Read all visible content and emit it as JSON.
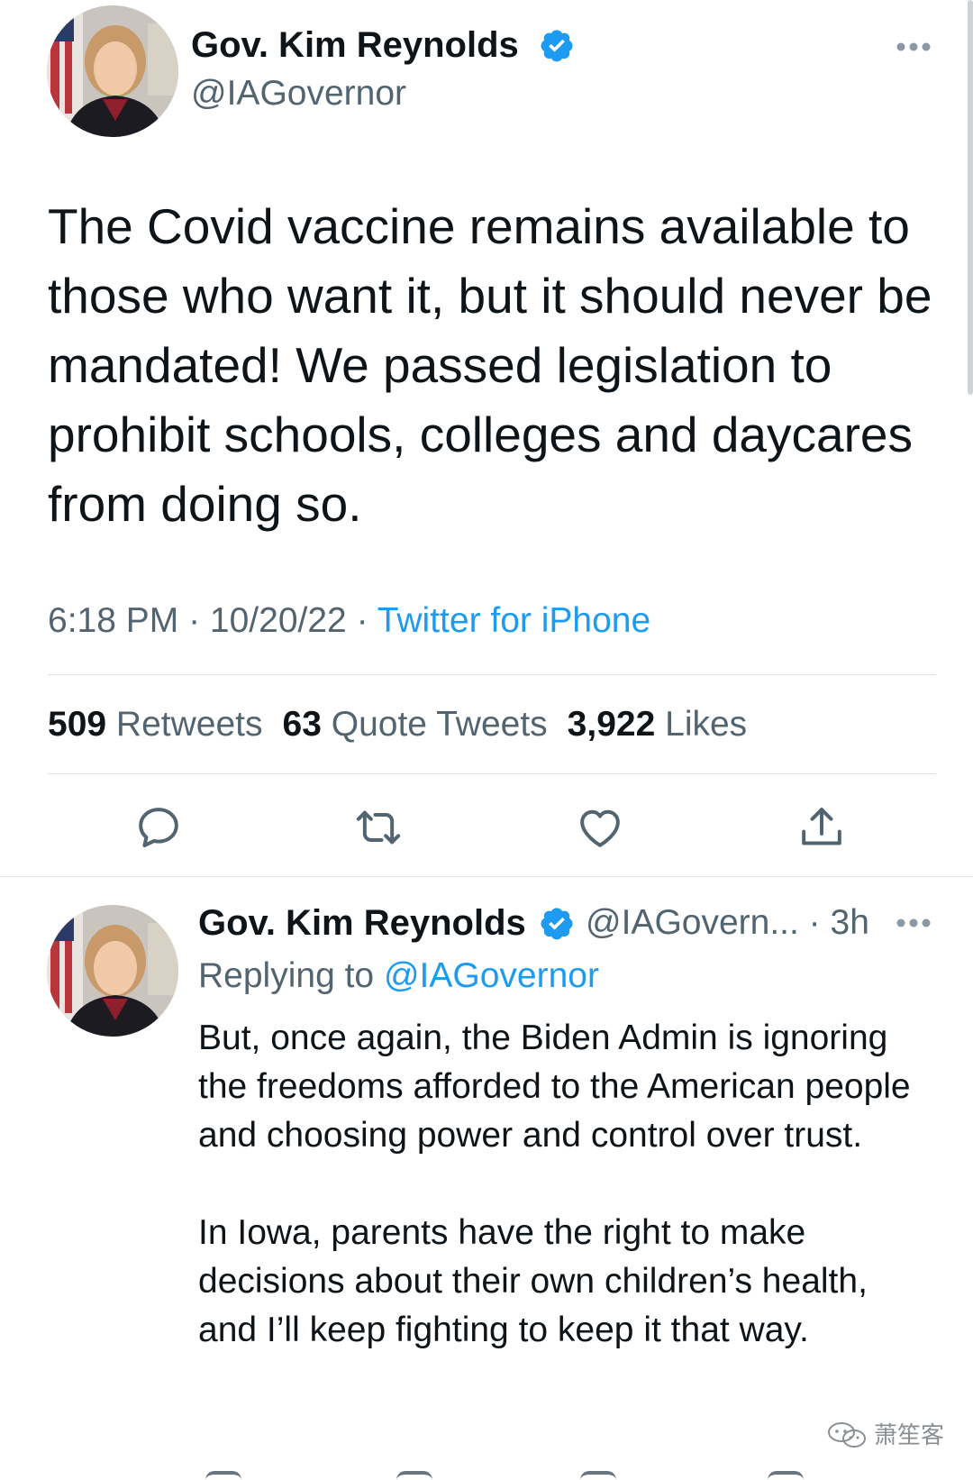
{
  "tweet": {
    "author_name": "Gov. Kim Reynolds",
    "handle": "@IAGovernor",
    "text": "The Covid vaccine remains available to those who want it, but it should never be mandated! We passed legislation to prohibit schools, colleges and daycares from doing so.",
    "time": "6:18 PM",
    "date": "10/20/22",
    "separator": " · ",
    "source": "Twitter for iPhone",
    "stats": {
      "retweets_count": "509",
      "retweets_label": "Retweets",
      "quotes_count": "63",
      "quotes_label": "Quote Tweets",
      "likes_count": "3,922",
      "likes_label": "Likes"
    }
  },
  "reply": {
    "author_name": "Gov. Kim Reynolds",
    "handle_truncated": "@IAGovern...",
    "separator": " · ",
    "age": "3h",
    "replying_to_label": "Replying to",
    "replying_to_handle": "@IAGovernor",
    "paragraph_1": "But, once again, the Biden Admin is ignoring the freedoms afforded to the American people and choosing power and control over trust.",
    "paragraph_2": "In Iowa, parents have the right to make decisions about their own children’s health, and I’ll keep fighting to keep it that way."
  },
  "watermark": {
    "text": "萧笙客",
    "icon": "wechat-icon"
  },
  "icons": {
    "verified": "verified-badge-icon",
    "more": "more-options-icon",
    "reply": "reply-icon",
    "retweet": "retweet-icon",
    "like": "like-icon",
    "share": "share-icon"
  },
  "colors": {
    "text_primary": "#0f1419",
    "text_secondary": "#536471",
    "accent": "#1d9bf0",
    "divider": "#dfe3e6"
  }
}
